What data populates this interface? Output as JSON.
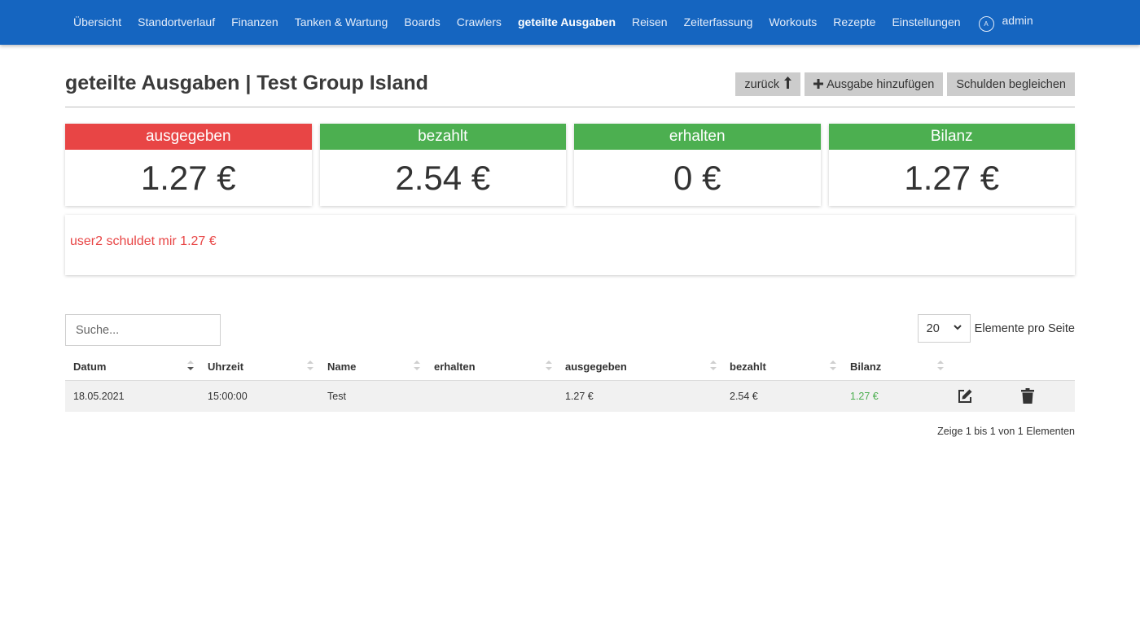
{
  "nav": {
    "items": [
      "Übersicht",
      "Standortverlauf",
      "Finanzen",
      "Tanken & Wartung",
      "Boards",
      "Crawlers",
      "geteilte Ausgaben",
      "Reisen",
      "Zeiterfassung",
      "Workouts",
      "Rezepte",
      "Einstellungen"
    ],
    "active": "geteilte Ausgaben",
    "user": "admin",
    "avatar_letter": "A"
  },
  "header": {
    "title": "geteilte Ausgaben | Test Group Island",
    "back_label": "zurück",
    "add_label": "Ausgabe hinzufügen",
    "settle_label": "Schulden begleichen"
  },
  "cards": [
    {
      "label": "ausgegeben",
      "value": "1.27 €",
      "color": "#e84545"
    },
    {
      "label": "bezahlt",
      "value": "2.54 €",
      "color": "#4caf50"
    },
    {
      "label": "erhalten",
      "value": "0 €",
      "color": "#4caf50"
    },
    {
      "label": "Bilanz",
      "value": "1.27 €",
      "color": "#4caf50"
    }
  ],
  "message": {
    "text": "user2 schuldet mir 1.27 €",
    "color": "#e84545"
  },
  "search": {
    "placeholder": "Suche..."
  },
  "page_size": {
    "value": "20",
    "label": "Elemente pro Seite"
  },
  "table": {
    "columns": [
      "Datum",
      "Uhrzeit",
      "Name",
      "erhalten",
      "ausgegeben",
      "bezahlt",
      "Bilanz"
    ],
    "sorted_column": "Datum",
    "rows": [
      {
        "datum": "18.05.2021",
        "uhrzeit": "15:00:00",
        "name": "Test",
        "erhalten": "",
        "ausgegeben": "1.27 €",
        "bezahlt": "2.54 €",
        "bilanz": "1.27 €"
      }
    ]
  },
  "info": "Zeige 1 bis 1 von 1 Elementen",
  "colors": {
    "navbar": "#1565c0",
    "green": "#4caf50",
    "red": "#e84545",
    "button": "#cccccc"
  }
}
